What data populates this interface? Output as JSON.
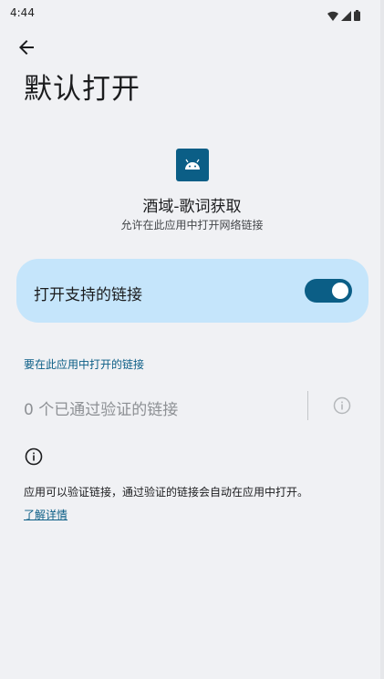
{
  "status_bar": {
    "time": "4:44"
  },
  "header": {
    "title": "默认打开"
  },
  "app": {
    "name": "酒域-歌词获取",
    "description": "允许在此应用中打开网络链接"
  },
  "toggle": {
    "label": "打开支持的链接",
    "enabled": true
  },
  "links_section": {
    "title": "要在此应用中打开的链接",
    "count_text": "0 个已通过验证的链接"
  },
  "footer": {
    "text": "应用可以验证链接，通过验证的链接会自动在应用中打开。",
    "learn_more": "了解详情"
  },
  "colors": {
    "accent": "#0b5e86",
    "card": "#c5e5fb",
    "background": "#f0f1f4"
  },
  "icons": [
    "back-arrow-icon",
    "android-icon",
    "info-icon",
    "wifi-icon",
    "signal-icon",
    "battery-icon"
  ]
}
